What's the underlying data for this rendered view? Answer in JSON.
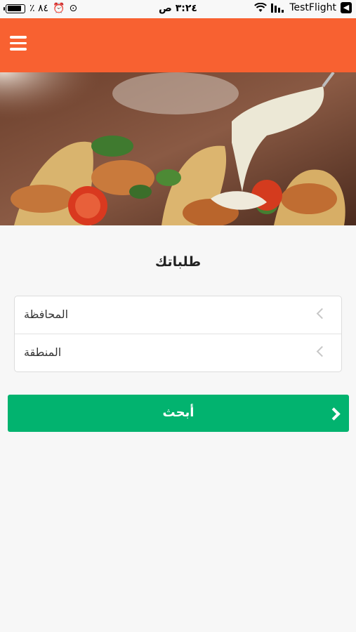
{
  "status_bar": {
    "battery_text": "٪ ٨٤",
    "alarm_icon": "⏰",
    "lock_icon": "⊙",
    "time": "٣:٢٤ ص",
    "carrier": "TestFlight",
    "battery_level": 0.84
  },
  "header": {
    "menu_icon": "hamburger-menu-icon",
    "background_color": "#f86131"
  },
  "hero": {
    "description_icon": "food-photo"
  },
  "main": {
    "title": "طلباتك",
    "picker_rows": [
      {
        "label": "المحافظة"
      },
      {
        "label": "المنطقة"
      }
    ],
    "search_label": "أبحث",
    "search_color": "#02b36f"
  }
}
